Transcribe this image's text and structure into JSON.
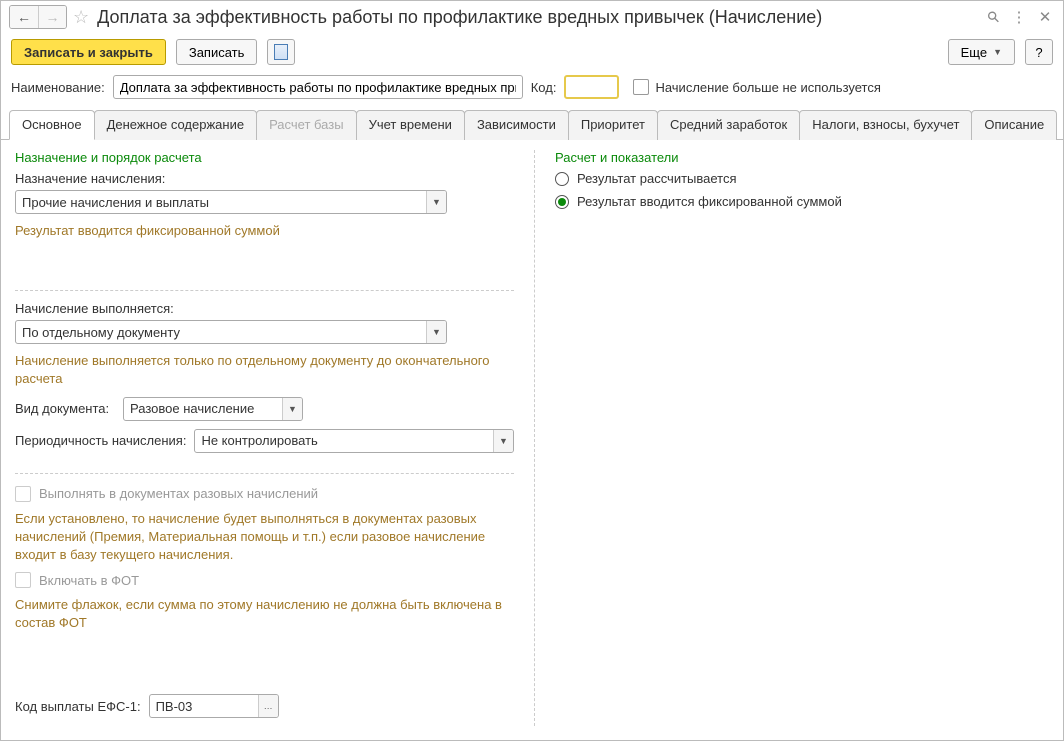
{
  "title": "Доплата за эффективность работы по профилактике вредных привычек (Начисление)",
  "toolbar": {
    "save_close": "Записать и закрыть",
    "save": "Записать",
    "more": "Еще",
    "help": "?"
  },
  "name_row": {
    "name_label": "Наименование:",
    "name_value": "Доплата за эффективность работы по профилактике вредных привь",
    "code_label": "Код:",
    "code_value": "",
    "not_used_label": "Начисление больше не используется"
  },
  "tabs": [
    {
      "label": "Основное",
      "active": true
    },
    {
      "label": "Денежное содержание"
    },
    {
      "label": "Расчет базы",
      "disabled": true
    },
    {
      "label": "Учет времени"
    },
    {
      "label": "Зависимости"
    },
    {
      "label": "Приоритет"
    },
    {
      "label": "Средний заработок"
    },
    {
      "label": "Налоги, взносы, бухучет"
    },
    {
      "label": "Описание"
    }
  ],
  "left": {
    "section1_title": "Назначение и порядок расчета",
    "purpose_label": "Назначение начисления:",
    "purpose_value": "Прочие начисления и выплаты",
    "result_note": "Результат вводится фиксированной суммой",
    "exec_label": "Начисление выполняется:",
    "exec_value": "По отдельному документу",
    "exec_note": "Начисление выполняется только по отдельному документу до окончательного расчета",
    "doc_type_label": "Вид документа:",
    "doc_type_value": "Разовое начисление",
    "period_label": "Периодичность начисления:",
    "period_value": "Не контролировать",
    "check1_label": "Выполнять в документах разовых начислений",
    "check1_note": "Если установлено, то начисление будет выполняться в документах разовых начислений (Премия, Материальная помощь и т.п.) если разовое начисление входит в базу текущего начисления.",
    "check2_label": "Включать в ФОТ",
    "check2_note": "Снимите флажок, если сумма по этому начислению не должна быть включена в состав ФОТ",
    "efs_label": "Код выплаты ЕФС-1:",
    "efs_value": "ПВ-03"
  },
  "right": {
    "section_title": "Расчет и показатели",
    "radio1": "Результат рассчитывается",
    "radio2": "Результат вводится фиксированной суммой"
  }
}
